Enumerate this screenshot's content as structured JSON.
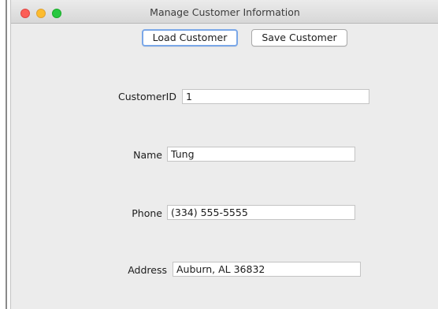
{
  "window": {
    "title": "Manage Customer Information"
  },
  "toolbar": {
    "load_label": "Load Customer",
    "save_label": "Save Customer"
  },
  "form": {
    "customer_id": {
      "label": "CustomerID",
      "value": "1"
    },
    "name": {
      "label": "Name",
      "value": "Tung"
    },
    "phone": {
      "label": "Phone",
      "value": "(334) 555-5555"
    },
    "address": {
      "label": "Address",
      "value": "Auburn, AL 36832"
    }
  },
  "colors": {
    "close": "#fc5f57",
    "minimize": "#fdbc2e",
    "maximize": "#28c840",
    "focus_ring": "#7aa7e8"
  }
}
